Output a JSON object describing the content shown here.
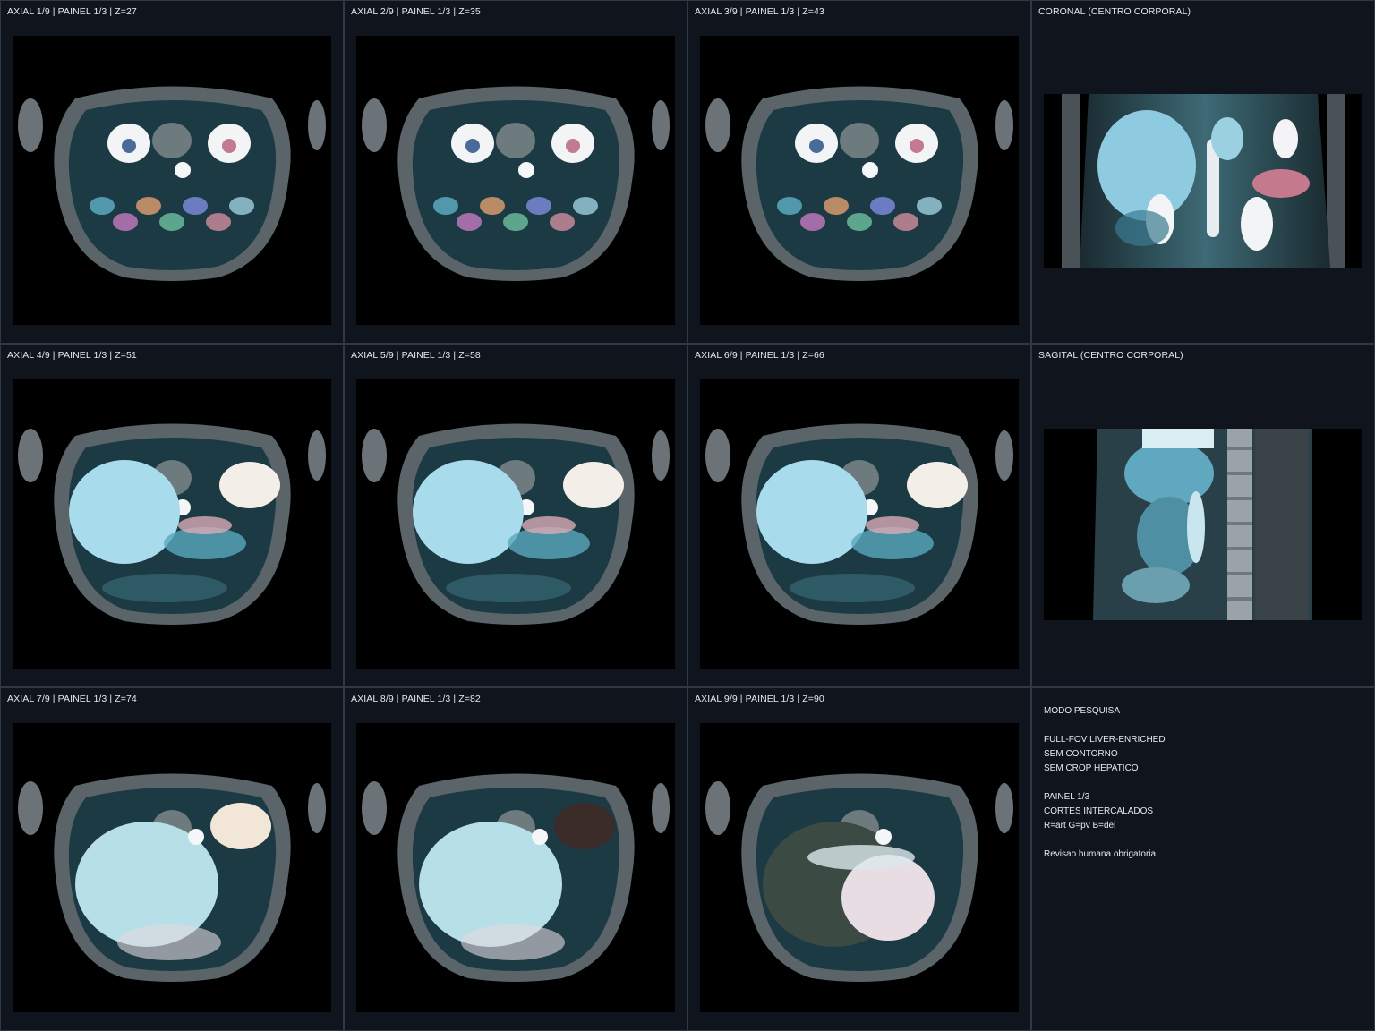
{
  "axial_panels": [
    {
      "label": "AXIAL 1/9 | PAINEL 1/3 | Z=27",
      "z": 27
    },
    {
      "label": "AXIAL 2/9 | PAINEL 1/3 | Z=35",
      "z": 35
    },
    {
      "label": "AXIAL 3/9 | PAINEL 1/3 | Z=43",
      "z": 43
    },
    {
      "label": "AXIAL 4/9 | PAINEL 1/3 | Z=51",
      "z": 51
    },
    {
      "label": "AXIAL 5/9 | PAINEL 1/3 | Z=58",
      "z": 58
    },
    {
      "label": "AXIAL 6/9 | PAINEL 1/3 | Z=66",
      "z": 66
    },
    {
      "label": "AXIAL 7/9 | PAINEL 1/3 | Z=74",
      "z": 74
    },
    {
      "label": "AXIAL 8/9 | PAINEL 1/3 | Z=82",
      "z": 82
    },
    {
      "label": "AXIAL 9/9 | PAINEL 1/3 | Z=90",
      "z": 90
    }
  ],
  "coronal": {
    "label": "CORONAL (CENTRO CORPORAL)"
  },
  "sagittal": {
    "label": "SAGITAL (CENTRO CORPORAL)"
  },
  "notes": {
    "mode": "MODO PESQUISA",
    "line1": "FULL-FOV LIVER-ENRICHED",
    "line2": "SEM CONTORNO",
    "line3": "SEM CROP HEPATICO",
    "panel": "PAINEL 1/3",
    "cuts": "CORTES INTERCALADOS",
    "channels": "R=art G=pv B=del",
    "warning": "Revisao humana obrigatoria."
  },
  "colors": {
    "background": "#0d1118",
    "cell": "#10151d",
    "border": "#2f3946",
    "text": "#e6eaef",
    "tissue_cyan": "#7fc6d6",
    "bright": "#f4f4f6"
  }
}
